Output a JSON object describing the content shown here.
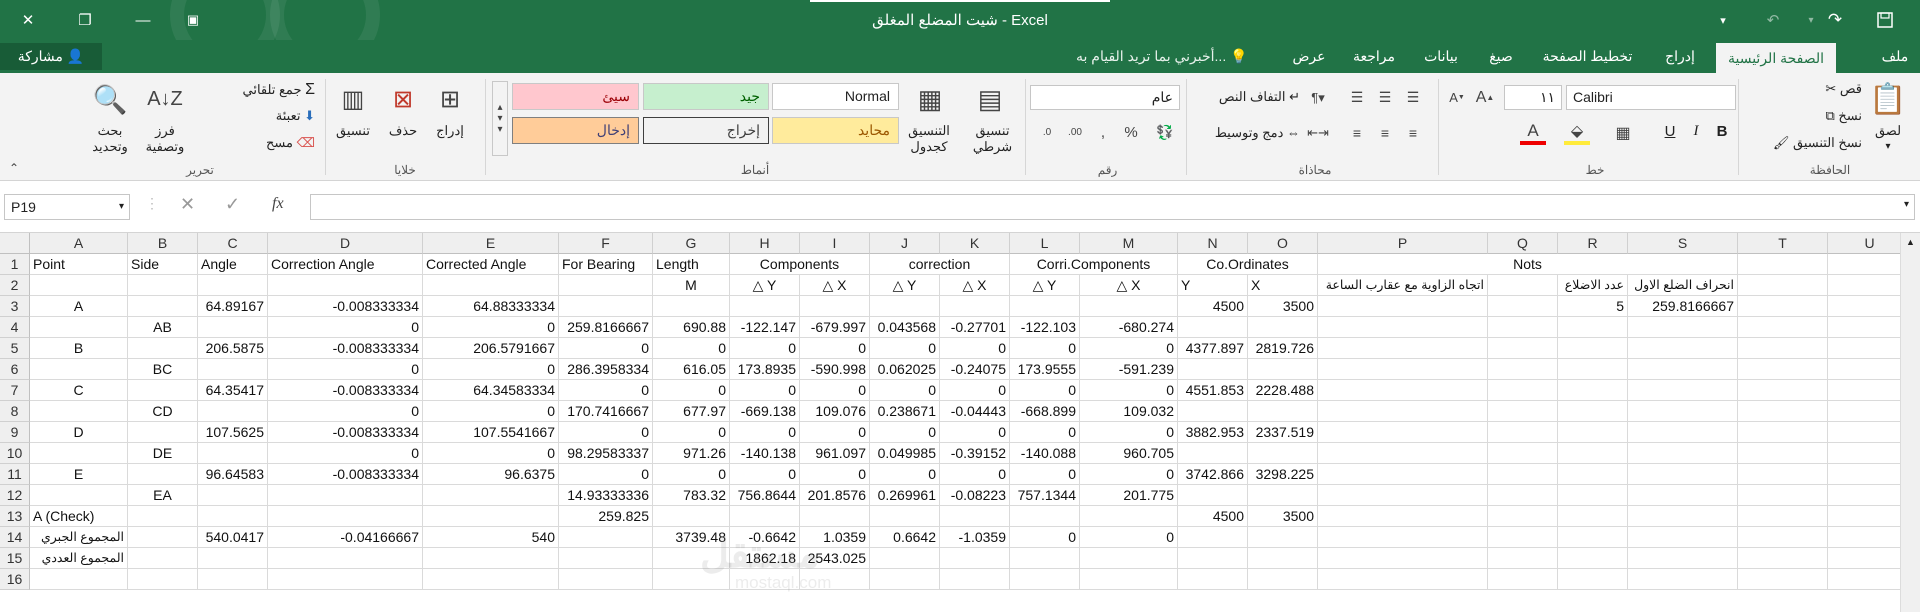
{
  "window": {
    "title": "شيت المضلع المغلق - Excel",
    "share": "مشاركة",
    "tell_me": "أخبرني بما تريد القيام به..."
  },
  "tabs": [
    "ملف",
    "الصفحة الرئيسية",
    "إدراج",
    "تخطيط الصفحة",
    "صيغ",
    "بيانات",
    "مراجعة",
    "عرض"
  ],
  "ribbon": {
    "clipboard": {
      "label": "الحافظة",
      "paste": "لصق",
      "cut": "قص",
      "copy": "نسخ",
      "format_painter": "نسخ التنسيق"
    },
    "font": {
      "label": "خط",
      "name": "Calibri",
      "size": "١١",
      "bold": "B",
      "italic": "I",
      "underline": "U"
    },
    "alignment": {
      "label": "محاذاة",
      "wrap": "التفاف النص",
      "merge": "دمج وتوسيط"
    },
    "number": {
      "label": "رقم",
      "format": "عام"
    },
    "styles": {
      "label": "أنماط",
      "conditional": "تنسيق شرطي",
      "as_table": "التنسيق كجدول",
      "cells": [
        "Normal",
        "جيد",
        "سيئ",
        "محايد",
        "إخراج",
        "إدخال"
      ]
    },
    "cells_group": {
      "label": "خلايا",
      "insert": "إدراج",
      "delete": "حذف",
      "format": "تنسيق"
    },
    "editing": {
      "label": "تحرير",
      "autosum": "جمع تلقائي",
      "fill": "تعبئة",
      "clear": "مسح",
      "sort": "فرز وتصفية",
      "find": "بحث وتحديد"
    }
  },
  "formula_bar": {
    "name_box": "P19",
    "fx": "fx",
    "value": ""
  },
  "columns": [
    "A",
    "B",
    "C",
    "D",
    "E",
    "F",
    "G",
    "H",
    "I",
    "J",
    "K",
    "L",
    "M",
    "N",
    "O",
    "P",
    "Q",
    "R",
    "S",
    "T",
    "U"
  ],
  "rows": [
    [
      "Point",
      "Side",
      "Angle",
      "Correction Angle",
      "Corrected Angle",
      "For Bearing",
      "Length",
      "Components",
      "",
      "correction",
      "",
      "Corri.Components",
      "",
      "Co.Ordinates",
      "",
      "Nots",
      "",
      "",
      "",
      "",
      ""
    ],
    [
      "",
      "",
      "",
      "",
      "",
      "",
      "M",
      "△ Y",
      "△ X",
      "△ Y",
      "△ X",
      "△ Y",
      "△ X",
      "Y",
      "X",
      "اتجاه الزاوية مع عقارب الساعة",
      "",
      "عدد الاضلاع",
      "انحراف الضلع الاول",
      "",
      ""
    ],
    [
      "A",
      "",
      "64.89167",
      "-0.008333334",
      "64.88333334",
      "",
      "",
      "",
      "",
      "",
      "",
      "",
      "",
      "4500",
      "3500",
      "",
      "",
      "5",
      "259.8166667",
      "",
      ""
    ],
    [
      "",
      "AB",
      "",
      "0",
      "0",
      "259.8166667",
      "690.88",
      "-122.147",
      "-679.997",
      "0.043568",
      "-0.27701",
      "-122.103",
      "-680.274",
      "",
      "",
      "",
      "",
      "",
      "",
      "",
      ""
    ],
    [
      "B",
      "",
      "206.5875",
      "-0.008333334",
      "206.5791667",
      "0",
      "0",
      "0",
      "0",
      "0",
      "0",
      "0",
      "0",
      "4377.897",
      "2819.726",
      "",
      "",
      "",
      "",
      "",
      ""
    ],
    [
      "",
      "BC",
      "",
      "0",
      "0",
      "286.3958334",
      "616.05",
      "173.8935",
      "-590.998",
      "0.062025",
      "-0.24075",
      "173.9555",
      "-591.239",
      "",
      "",
      "",
      "",
      "",
      "",
      "",
      ""
    ],
    [
      "C",
      "",
      "64.35417",
      "-0.008333334",
      "64.34583334",
      "0",
      "0",
      "0",
      "0",
      "0",
      "0",
      "0",
      "0",
      "4551.853",
      "2228.488",
      "",
      "",
      "",
      "",
      "",
      ""
    ],
    [
      "",
      "CD",
      "",
      "0",
      "0",
      "170.7416667",
      "677.97",
      "-669.138",
      "109.076",
      "0.238671",
      "-0.04443",
      "-668.899",
      "109.032",
      "",
      "",
      "",
      "",
      "",
      "",
      "",
      ""
    ],
    [
      "D",
      "",
      "107.5625",
      "-0.008333334",
      "107.5541667",
      "0",
      "0",
      "0",
      "0",
      "0",
      "0",
      "0",
      "0",
      "3882.953",
      "2337.519",
      "",
      "",
      "",
      "",
      "",
      ""
    ],
    [
      "",
      "DE",
      "",
      "0",
      "0",
      "98.29583337",
      "971.26",
      "-140.138",
      "961.097",
      "0.049985",
      "-0.39152",
      "-140.088",
      "960.705",
      "",
      "",
      "",
      "",
      "",
      "",
      "",
      ""
    ],
    [
      "E",
      "",
      "96.64583",
      "-0.008333334",
      "96.6375",
      "0",
      "0",
      "0",
      "0",
      "0",
      "0",
      "0",
      "0",
      "3742.866",
      "3298.225",
      "",
      "",
      "",
      "",
      "",
      ""
    ],
    [
      "",
      "EA",
      "",
      "",
      "",
      "14.93333336",
      "783.32",
      "756.8644",
      "201.8576",
      "0.269961",
      "-0.08223",
      "757.1344",
      "201.775",
      "",
      "",
      "",
      "",
      "",
      "",
      "",
      ""
    ],
    [
      "A  (Check)",
      "",
      "",
      "",
      "",
      "259.825",
      "",
      "",
      "",
      "",
      "",
      "",
      "",
      "4500",
      "3500",
      "",
      "",
      "",
      "",
      "",
      ""
    ],
    [
      "المجموع الجبري",
      "",
      "540.0417",
      "-0.04166667",
      "540",
      "",
      "3739.48",
      "-0.6642",
      "1.0359",
      "0.6642",
      "-1.0359",
      "0",
      "0",
      "",
      "",
      "",
      "",
      "",
      "",
      "",
      ""
    ],
    [
      "المجموع العددي",
      "",
      "",
      "",
      "",
      "",
      "",
      "1862.18",
      "2543.025",
      "",
      "",
      "",
      "",
      "",
      "",
      "",
      "",
      "",
      "",
      "",
      ""
    ],
    [
      "",
      "",
      "",
      "",
      "",
      "",
      "",
      "",
      "",
      "",
      "",
      "",
      "",
      "",
      "",
      "",
      "",
      "",
      "",
      "",
      ""
    ]
  ],
  "watermark": {
    "line1": "مستقل",
    "line2": "mostaql.com"
  }
}
